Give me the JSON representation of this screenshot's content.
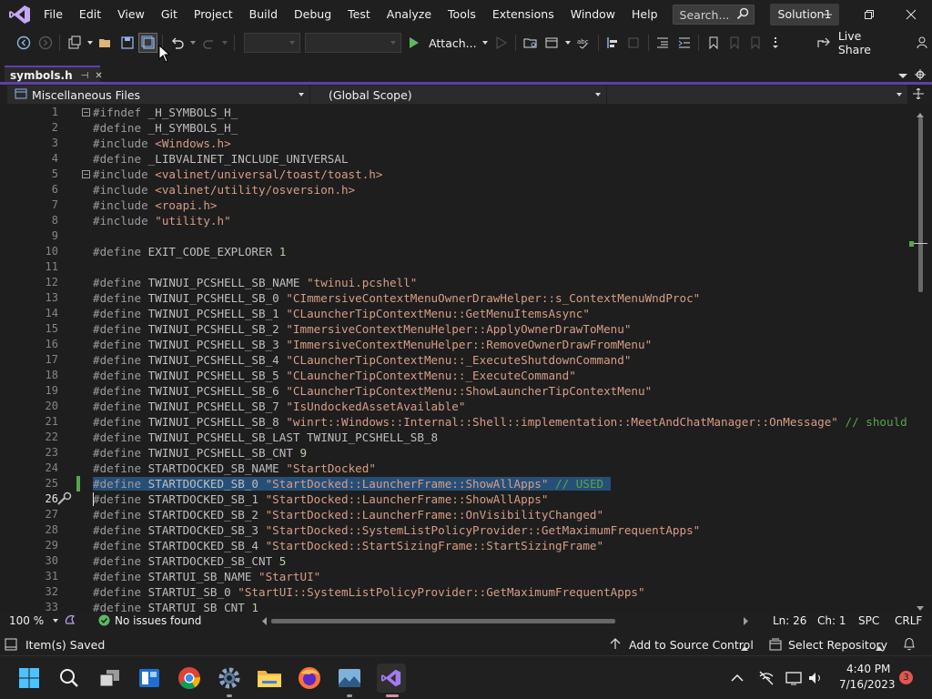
{
  "menu": [
    "File",
    "Edit",
    "View",
    "Git",
    "Project",
    "Build",
    "Debug",
    "Test",
    "Analyze",
    "Tools",
    "Extensions",
    "Window",
    "Help"
  ],
  "search": {
    "placeholder": "Search..."
  },
  "solution_name": "Solution1",
  "toolbar": {
    "attach_label": "Attach...",
    "live_share_label": "Live Share"
  },
  "tab": {
    "name": "symbols.h",
    "pin": "⊣",
    "close": "✕"
  },
  "nav": {
    "project": "Miscellaneous Files",
    "scope": "(Global Scope)",
    "member": ""
  },
  "editor": {
    "first_line": 1,
    "current_line": 26,
    "highlight_line": 25,
    "lines": [
      [
        [
          "kw",
          "#ifndef "
        ],
        [
          "mac",
          "_H_SYMBOLS_H_"
        ]
      ],
      [
        [
          "kw",
          "#define "
        ],
        [
          "mac",
          "_H_SYMBOLS_H_"
        ]
      ],
      [
        [
          "kw",
          "#include "
        ],
        [
          "str",
          "<Windows.h>"
        ]
      ],
      [
        [
          "kw",
          "#define "
        ],
        [
          "mac",
          "_LIBVALINET_INCLUDE_UNIVERSAL"
        ]
      ],
      [
        [
          "kw",
          "#include "
        ],
        [
          "str",
          "<valinet/universal/toast/toast.h>"
        ]
      ],
      [
        [
          "kw",
          "#include "
        ],
        [
          "str",
          "<valinet/utility/osversion.h>"
        ]
      ],
      [
        [
          "kw",
          "#include "
        ],
        [
          "str",
          "<roapi.h>"
        ]
      ],
      [
        [
          "kw",
          "#include "
        ],
        [
          "str",
          "\"utility.h\""
        ]
      ],
      [],
      [
        [
          "kw",
          "#define "
        ],
        [
          "mac",
          "EXIT_CODE_EXPLORER "
        ],
        [
          "num",
          "1"
        ]
      ],
      [],
      [
        [
          "kw",
          "#define "
        ],
        [
          "mac",
          "TWINUI_PCSHELL_SB_NAME "
        ],
        [
          "str",
          "\"twinui.pcshell\""
        ]
      ],
      [
        [
          "kw",
          "#define "
        ],
        [
          "mac",
          "TWINUI_PCSHELL_SB_0 "
        ],
        [
          "str",
          "\"CImmersiveContextMenuOwnerDrawHelper::s_ContextMenuWndProc\""
        ]
      ],
      [
        [
          "kw",
          "#define "
        ],
        [
          "mac",
          "TWINUI_PCSHELL_SB_1 "
        ],
        [
          "str",
          "\"CLauncherTipContextMenu::GetMenuItemsAsync\""
        ]
      ],
      [
        [
          "kw",
          "#define "
        ],
        [
          "mac",
          "TWINUI_PCSHELL_SB_2 "
        ],
        [
          "str",
          "\"ImmersiveContextMenuHelper::ApplyOwnerDrawToMenu\""
        ]
      ],
      [
        [
          "kw",
          "#define "
        ],
        [
          "mac",
          "TWINUI_PCSHELL_SB_3 "
        ],
        [
          "str",
          "\"ImmersiveContextMenuHelper::RemoveOwnerDrawFromMenu\""
        ]
      ],
      [
        [
          "kw",
          "#define "
        ],
        [
          "mac",
          "TWINUI_PCSHELL_SB_4 "
        ],
        [
          "str",
          "\"CLauncherTipContextMenu::_ExecuteShutdownCommand\""
        ]
      ],
      [
        [
          "kw",
          "#define "
        ],
        [
          "mac",
          "TWINUI_PCSHELL_SB_5 "
        ],
        [
          "str",
          "\"CLauncherTipContextMenu::_ExecuteCommand\""
        ]
      ],
      [
        [
          "kw",
          "#define "
        ],
        [
          "mac",
          "TWINUI_PCSHELL_SB_6 "
        ],
        [
          "str",
          "\"CLauncherTipContextMenu::ShowLauncherTipContextMenu\""
        ]
      ],
      [
        [
          "kw",
          "#define "
        ],
        [
          "mac",
          "TWINUI_PCSHELL_SB_7 "
        ],
        [
          "str",
          "\"IsUndockedAssetAvailable\""
        ]
      ],
      [
        [
          "kw",
          "#define "
        ],
        [
          "mac",
          "TWINUI_PCSHELL_SB_8 "
        ],
        [
          "str",
          "\"winrt::Windows::Internal::Shell::implementation::MeetAndChatManager::OnMessage\""
        ],
        [
          "cmt",
          " // should"
        ]
      ],
      [
        [
          "kw",
          "#define "
        ],
        [
          "mac",
          "TWINUI_PCSHELL_SB_LAST TWINUI_PCSHELL_SB_8"
        ]
      ],
      [
        [
          "kw",
          "#define "
        ],
        [
          "mac",
          "TWINUI_PCSHELL_SB_CNT "
        ],
        [
          "num",
          "9"
        ]
      ],
      [
        [
          "kw",
          "#define "
        ],
        [
          "mac",
          "STARTDOCKED_SB_NAME "
        ],
        [
          "str",
          "\"StartDocked\""
        ]
      ],
      [
        [
          "kw",
          "#define "
        ],
        [
          "mac",
          "STARTDOCKED_SB_0 "
        ],
        [
          "str",
          "\"StartDocked::LauncherFrame::ShowAllApps\""
        ],
        [
          "cmt",
          " // USED "
        ]
      ],
      [
        [
          "kw",
          "#define "
        ],
        [
          "mac",
          "STARTDOCKED_SB_1 "
        ],
        [
          "str",
          "\"StartDocked::LauncherFrame::ShowAllApps\""
        ]
      ],
      [
        [
          "kw",
          "#define "
        ],
        [
          "mac",
          "STARTDOCKED_SB_2 "
        ],
        [
          "str",
          "\"StartDocked::LauncherFrame::OnVisibilityChanged\""
        ]
      ],
      [
        [
          "kw",
          "#define "
        ],
        [
          "mac",
          "STARTDOCKED_SB_3 "
        ],
        [
          "str",
          "\"StartDocked::SystemListPolicyProvider::GetMaximumFrequentApps\""
        ]
      ],
      [
        [
          "kw",
          "#define "
        ],
        [
          "mac",
          "STARTDOCKED_SB_4 "
        ],
        [
          "str",
          "\"StartDocked::StartSizingFrame::StartSizingFrame\""
        ]
      ],
      [
        [
          "kw",
          "#define "
        ],
        [
          "mac",
          "STARTDOCKED_SB_CNT "
        ],
        [
          "num",
          "5"
        ]
      ],
      [
        [
          "kw",
          "#define "
        ],
        [
          "mac",
          "STARTUI_SB_NAME "
        ],
        [
          "str",
          "\"StartUI\""
        ]
      ],
      [
        [
          "kw",
          "#define "
        ],
        [
          "mac",
          "STARTUI_SB_0 "
        ],
        [
          "str",
          "\"StartUI::SystemListPolicyProvider::GetMaximumFrequentApps\""
        ]
      ],
      [
        [
          "kw",
          "#define "
        ],
        [
          "mac",
          "STARTUI_SB_CNT "
        ],
        [
          "num",
          "1"
        ]
      ]
    ]
  },
  "editor_status": {
    "zoom": "100 %",
    "issues": "No issues found",
    "line": "Ln: 26",
    "col": "Ch: 1",
    "whitespace": "SPC",
    "eol": "CRLF"
  },
  "status": {
    "message": "Item(s) Saved",
    "source_control": "Add to Source Control",
    "repository": "Select Repository"
  },
  "clock": {
    "time": "4:40 PM",
    "date": "7/16/2023",
    "notifications": "3"
  },
  "colors": {
    "accent": "#5e3fae",
    "selection": "#264f78",
    "string": "#d69d85",
    "comment": "#57a64a",
    "number": "#b5cea8"
  }
}
